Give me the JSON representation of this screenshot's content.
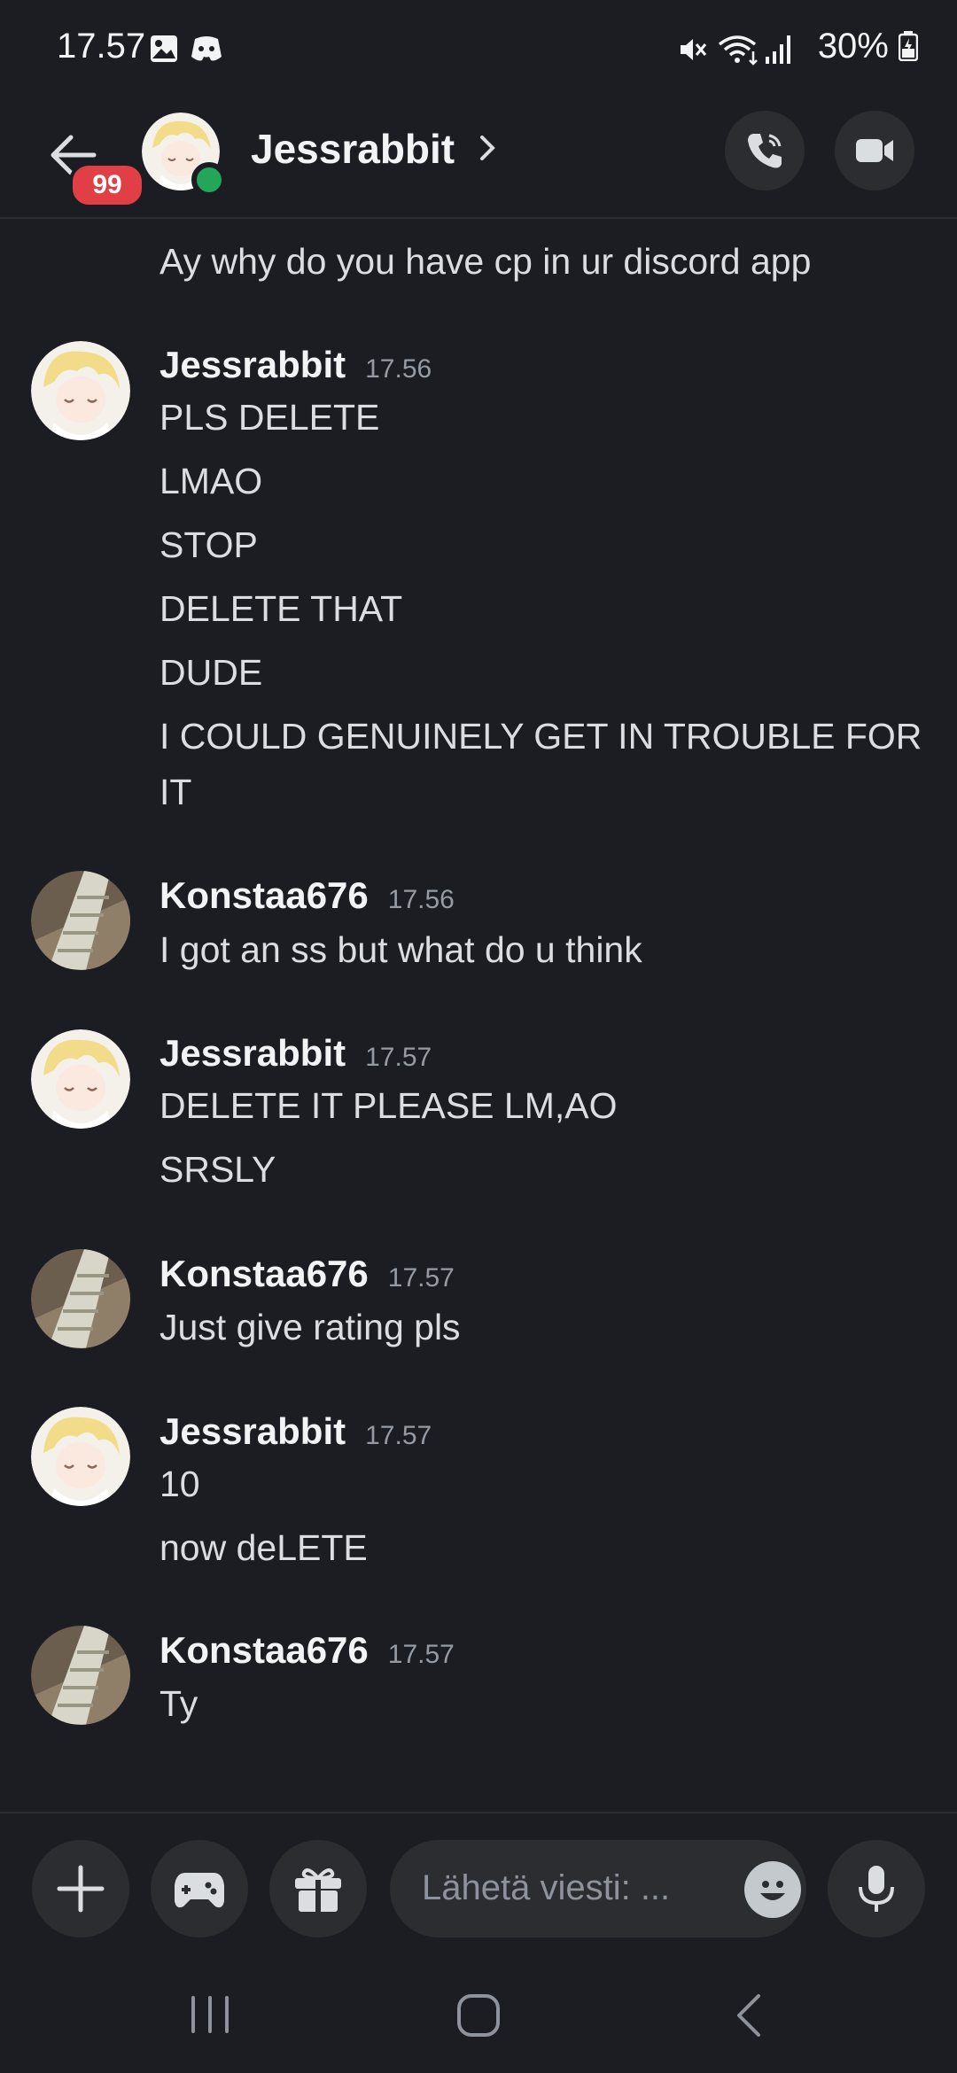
{
  "status_bar": {
    "time": "17.57",
    "battery": "30%"
  },
  "header": {
    "unread_badge": "99",
    "contact_name": "Jessrabbit"
  },
  "messages": {
    "continuation": "Ay why do you have cp in ur discord app",
    "groups": [
      {
        "author": "Jessrabbit",
        "time": "17.56",
        "lines": [
          "PLS DELETE",
          "LMAO",
          "STOP",
          "DELETE THAT",
          "DUDE",
          "I COULD GENUINELY GET IN TROUBLE FOR",
          "IT"
        ]
      },
      {
        "author": "Konstaa676",
        "time": "17.56",
        "lines": [
          "I got an ss but what do u think"
        ]
      },
      {
        "author": "Jessrabbit",
        "time": "17.57",
        "lines": [
          "DELETE IT PLEASE LM,AO",
          "SRSLY"
        ]
      },
      {
        "author": "Konstaa676",
        "time": "17.57",
        "lines": [
          "Just give rating pls"
        ]
      },
      {
        "author": "Jessrabbit",
        "time": "17.57",
        "lines": [
          "10",
          "now deLETE"
        ]
      },
      {
        "author": "Konstaa676",
        "time": "17.57",
        "lines": [
          "Ty"
        ]
      }
    ]
  },
  "composer": {
    "placeholder": "Lähetä viesti: ..."
  },
  "icons": {
    "status": [
      "gallery-icon",
      "discord-icon",
      "mute-icon",
      "wifi-icon",
      "signal-icon",
      "battery-icon"
    ],
    "header": [
      "back-arrow-icon",
      "phone-icon",
      "video-camera-icon",
      "chevron-right-icon"
    ],
    "composer": [
      "plus-icon",
      "gamepad-icon",
      "gift-icon",
      "emoji-icon",
      "microphone-icon"
    ],
    "nav": [
      "recents-icon",
      "home-icon",
      "back-icon"
    ]
  },
  "colors": {
    "background": "#1c1d22",
    "online": "#23a55a",
    "badge": "#e04045"
  }
}
